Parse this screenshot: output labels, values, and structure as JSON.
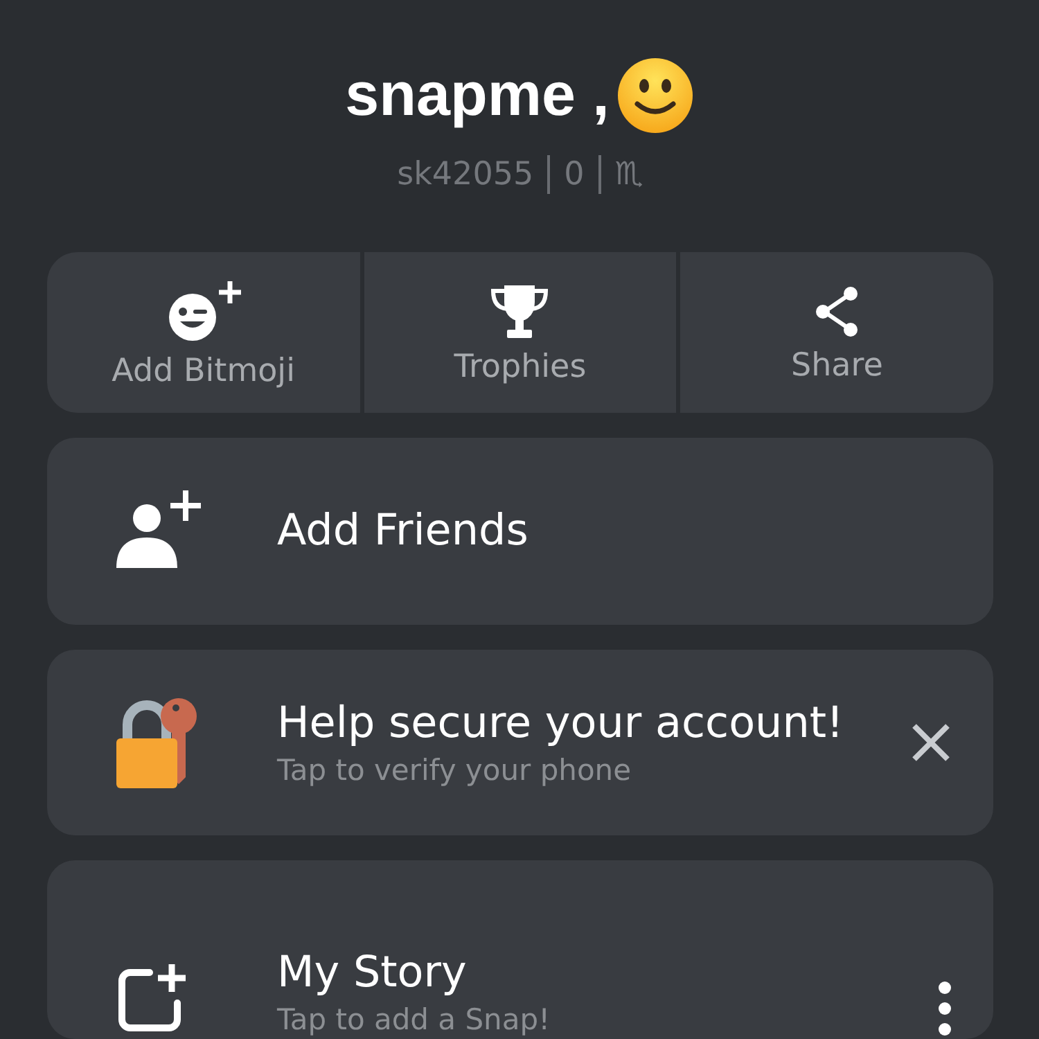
{
  "profile": {
    "display_name": "snapme ,",
    "username": "sk42055",
    "score": "0",
    "zodiac": "♏"
  },
  "actions": [
    {
      "kind": "bitmoji",
      "label": "Add Bitmoji"
    },
    {
      "kind": "trophy",
      "label": "Trophies"
    },
    {
      "kind": "share",
      "label": "Share"
    }
  ],
  "cards": [
    {
      "kind": "friends",
      "title": "Add Friends"
    },
    {
      "kind": "security",
      "title": "Help secure your account!",
      "subtitle": "Tap to verify your phone",
      "dismissible": true
    },
    {
      "kind": "story",
      "title": "My Story",
      "subtitle": "Tap to add a Snap!",
      "menu": true
    }
  ]
}
